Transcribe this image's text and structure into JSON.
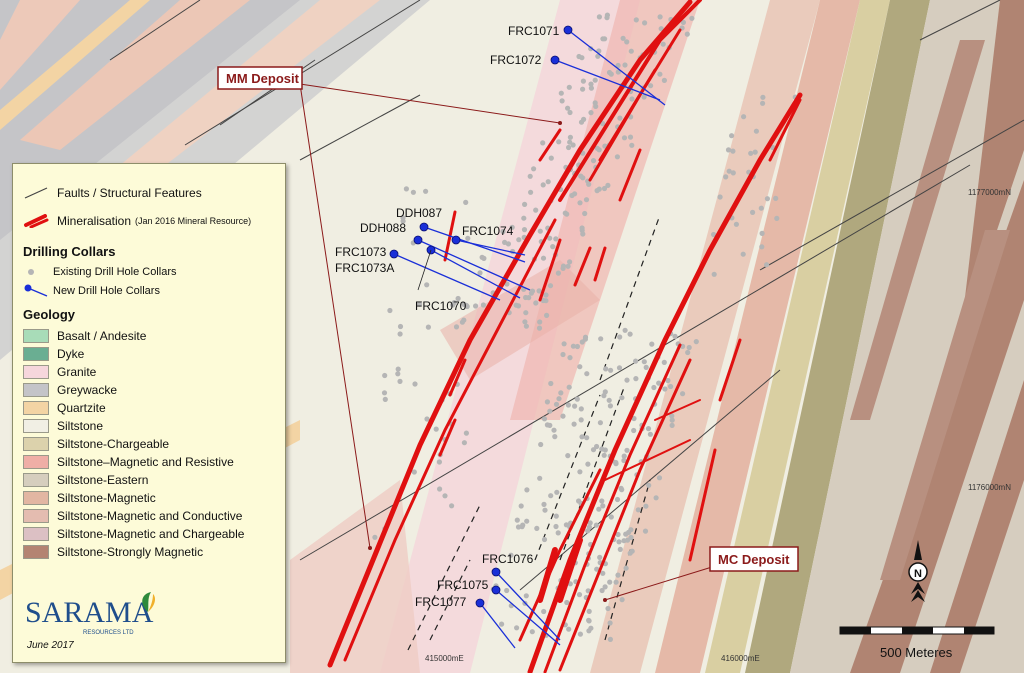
{
  "callouts": {
    "mm_deposit": "MM Deposit",
    "mc_deposit": "MC Deposit"
  },
  "holes": [
    {
      "id": "frc1071",
      "label": "FRC1071"
    },
    {
      "id": "frc1072",
      "label": "FRC1072"
    },
    {
      "id": "ddh087",
      "label": "DDH087"
    },
    {
      "id": "ddh088",
      "label": "DDH088"
    },
    {
      "id": "frc1074",
      "label": "FRC1074"
    },
    {
      "id": "frc1073",
      "label": "FRC1073"
    },
    {
      "id": "frc1073a",
      "label": "FRC1073A"
    },
    {
      "id": "frc1070",
      "label": "FRC1070"
    },
    {
      "id": "frc1076",
      "label": "FRC1076"
    },
    {
      "id": "frc1075",
      "label": "FRC1075"
    },
    {
      "id": "frc1077",
      "label": "FRC1077"
    }
  ],
  "grid": {
    "northing_1": "1177000mN",
    "northing_2": "1176000mN",
    "easting_1": "415000mE",
    "easting_2": "416000mE"
  },
  "scale_bar": {
    "label": "500 Meteres"
  },
  "north_arrow": {
    "letter": "N"
  },
  "legend": {
    "faults": "Faults / Structural Features",
    "mineralisation": "Mineralisation",
    "mineralisation_note": "(Jan 2016 Mineral Resource)",
    "drilling_header": "Drilling Collars",
    "existing_collars": "Existing Drill Hole Collars",
    "new_collars": "New Drill Hole Collars",
    "geology_header": "Geology",
    "geology_units": [
      {
        "name": "Basalt / Andesite",
        "color": "#a8dcb8"
      },
      {
        "name": "Dyke",
        "color": "#6aae92"
      },
      {
        "name": "Granite",
        "color": "#f6d6dc"
      },
      {
        "name": "Greywacke",
        "color": "#c4c4c8"
      },
      {
        "name": "Quartzite",
        "color": "#f3d4a4"
      },
      {
        "name": "Siltstone",
        "color": "#f1efe4"
      },
      {
        "name": "Siltstone-Chargeable",
        "color": "#dcd2ac"
      },
      {
        "name": "Siltstone–Magnetic and Resistive",
        "color": "#efaea6"
      },
      {
        "name": "Siltstone-Eastern",
        "color": "#d6cebe"
      },
      {
        "name": "Siltstone-Magnetic",
        "color": "#e2b6a2"
      },
      {
        "name": "Siltstone-Magnetic and Conductive",
        "color": "#e4bcb0"
      },
      {
        "name": "Siltstone-Magnetic and Chargeable",
        "color": "#dcc0c4"
      },
      {
        "name": "Siltstone-Strongly Magnetic",
        "color": "#b48472"
      }
    ],
    "company": "SARAMA",
    "company_sub": "RESOURCES LTD",
    "date": "June 2017"
  }
}
